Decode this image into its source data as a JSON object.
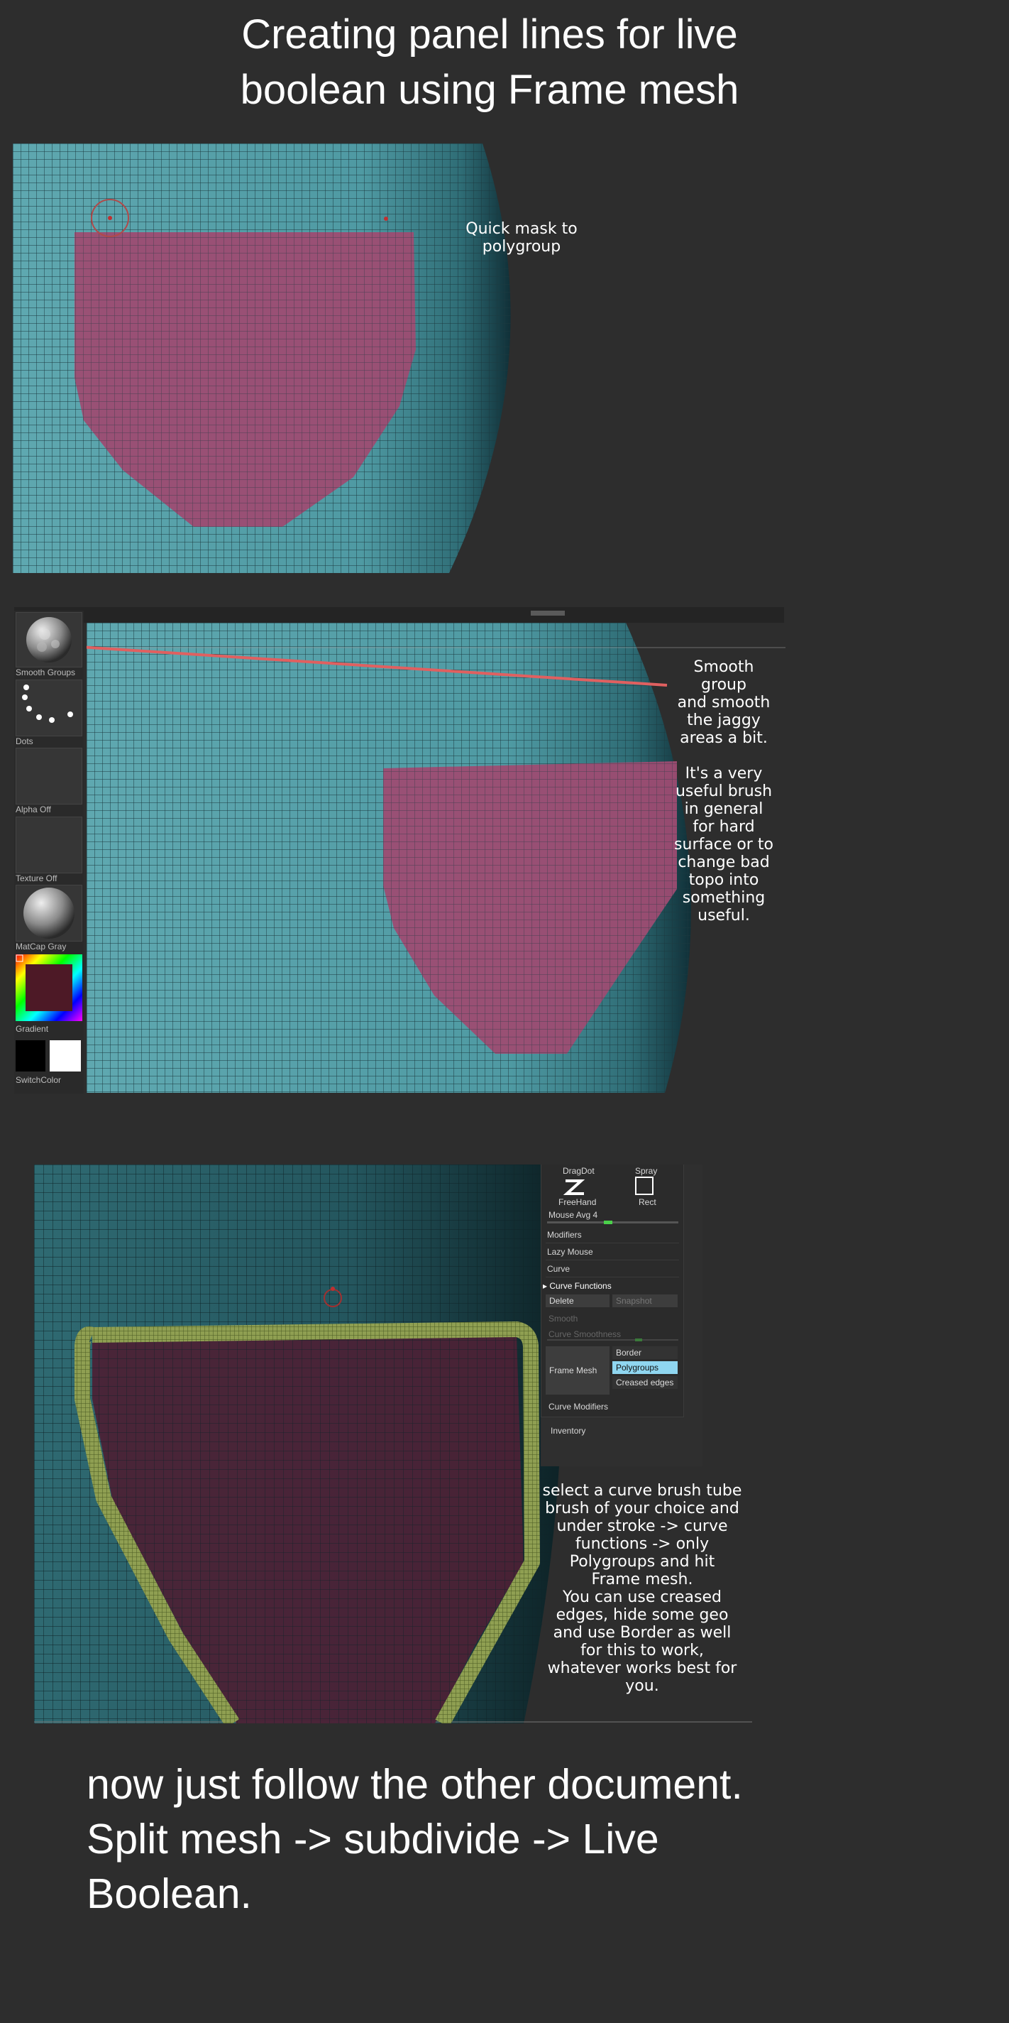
{
  "title": {
    "line1": "Creating panel lines for live",
    "line2": "boolean using Frame mesh"
  },
  "panel1": {
    "note": [
      "Quick mask to",
      "polygroup"
    ]
  },
  "panel2": {
    "sidebar": {
      "brush_label": "Smooth Groups",
      "stroke_label": "Dots",
      "alpha_label": "Alpha Off",
      "texture_label": "Texture Off",
      "material_label": "MatCap Gray",
      "gradient_label": "Gradient",
      "switch_label": "SwitchColor"
    },
    "note": [
      "Smooth",
      "group",
      "and smooth",
      "the jaggy",
      "areas a bit.",
      "",
      "It's a very",
      "useful brush",
      "in general",
      "for hard",
      "surface or to",
      "change bad",
      "topo into",
      "something",
      "useful."
    ]
  },
  "panel3": {
    "menu": {
      "dragdot": "DragDot",
      "spray": "Spray",
      "freehand": "FreeHand",
      "rect": "Rect",
      "mouse_avg": "Mouse Avg 4",
      "modifiers": "Modifiers",
      "lazy_mouse": "Lazy Mouse",
      "curve": "Curve",
      "curve_functions": "Curve Functions",
      "delete": "Delete",
      "snapshot": "Snapshot",
      "smooth": "Smooth",
      "curve_smoothness": "Curve Smoothness",
      "frame_mesh": "Frame Mesh",
      "border": "Border",
      "polygroups": "Polygroups",
      "creased_edges": "Creased edges",
      "curve_modifiers": "Curve Modifiers",
      "inventory": "Inventory"
    },
    "note": [
      "select a curve brush tube",
      "brush of your choice and",
      "under stroke -> curve",
      "functions -> only",
      "Polygroups and hit",
      "Frame mesh.",
      "You can use creased",
      "edges, hide some geo",
      "and use Border as well",
      "for this to work,",
      "whatever works best for",
      "you."
    ]
  },
  "footer": {
    "line1": "now just follow the other document.",
    "line2": "Split mesh -> subdivide -> Live",
    "line3": "Boolean."
  },
  "colors": {
    "mesh_teal": "#5aa0a8",
    "polygroup_pink": "#a04a72",
    "tube_green": "#8a9a4a",
    "highlight_blue": "#8fd6f0"
  }
}
